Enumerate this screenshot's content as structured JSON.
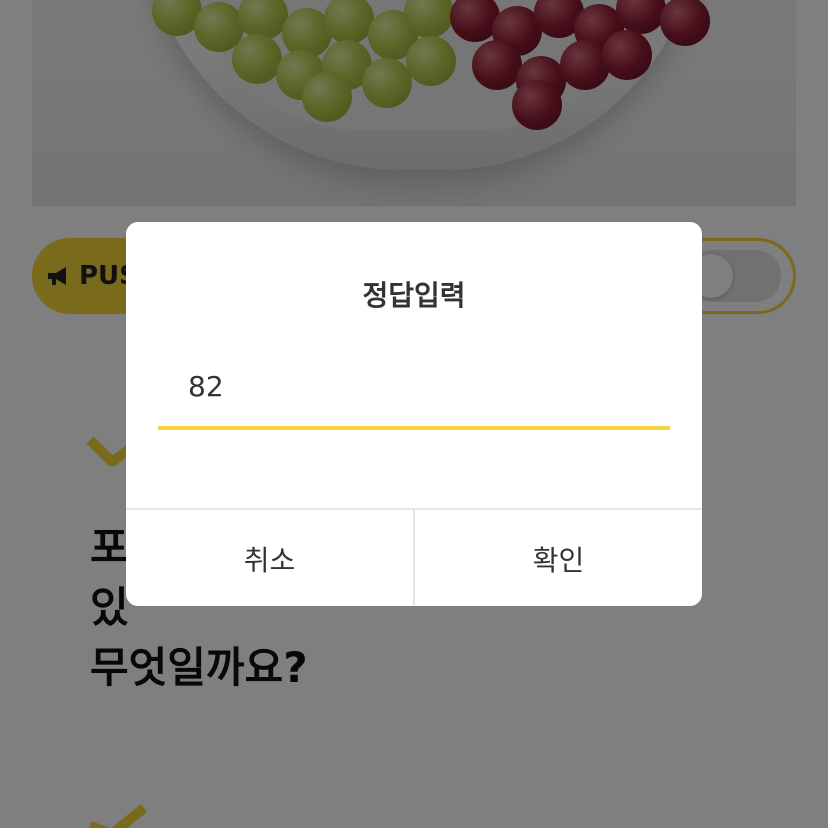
{
  "background": {
    "push_banner": {
      "label": "PUSH",
      "toggle_on": false
    },
    "question_lines": [
      "포",
      "있",
      "무엇일까요?"
    ]
  },
  "dialog": {
    "title": "정답입력",
    "answer_value": "82",
    "cancel_label": "취소",
    "confirm_label": "확인"
  },
  "colors": {
    "accent_yellow": "#f5d537",
    "overlay": "rgba(0,0,0,0.5)"
  }
}
